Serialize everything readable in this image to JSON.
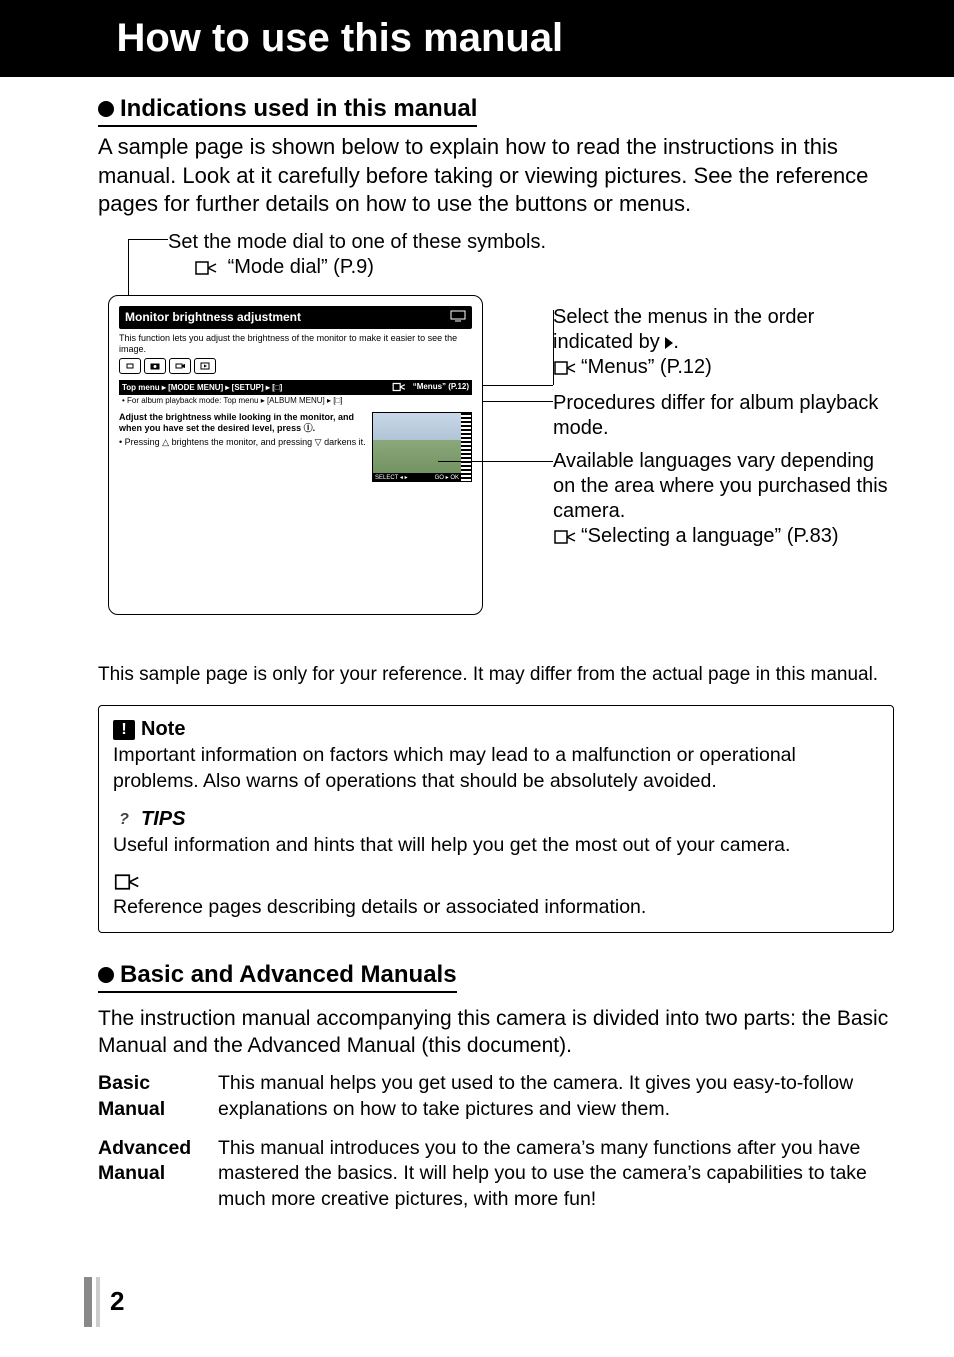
{
  "header": {
    "title": "How to use this manual"
  },
  "section1": {
    "heading": "Indications used in this manual",
    "intro": "A sample page is shown below to explain how to read the instructions in this manual. Look at it carefully before taking or viewing pictures. See the reference pages for further details on how to use the buttons or menus."
  },
  "diagram": {
    "mode_note_line1": "Set the mode dial to one of these symbols.",
    "mode_note_ref": "“Mode dial” (P.9)",
    "sample": {
      "title": "Monitor brightness adjustment",
      "subtitle": "This function lets you adjust the brightness of the monitor to make it easier to see the image.",
      "top_menu": "Top menu ▸ [MODE MENU] ▸ [SETUP] ▸ [□]",
      "top_menu_ref": "“Menus” (P.12)",
      "album_line": "• For album playback mode: Top menu ▸ [ALBUM MENU] ▸ [□]",
      "instr_bold": "Adjust the brightness while looking in the monitor, and when you have set the desired level, press Ⓘ.",
      "instr_sub": "•  Pressing △ brightens the monitor, and pressing ▽ darkens it.",
      "photo_select": "SELECT ◂ ▸",
      "photo_go": "GO ▸ OK"
    },
    "annot1_a": "Select the menus in the order indicated by",
    "annot1_ref": "“Menus” (P.12)",
    "annot2": "Procedures differ for album playback mode.",
    "annot3_a": "Available languages vary depending on the area where you purchased this camera.",
    "annot3_ref": "“Selecting a language” (P.83)",
    "caption": "This sample page is only for your reference. It may differ from the actual page in this manual."
  },
  "notes": {
    "note_head": "Note",
    "note_body": "Important information on factors which may lead to a malfunction or operational problems. Also warns of operations that should be absolutely avoided.",
    "tips_head": "TIPS",
    "tips_body": "Useful information and hints that will help you get the most out of your camera.",
    "ref_body": "Reference pages describing details or associated information."
  },
  "section2": {
    "heading": "Basic and Advanced Manuals",
    "intro": "The instruction manual accompanying this camera is divided into two parts: the Basic Manual and the Advanced Manual (this document).",
    "basic_label": "Basic Manual",
    "basic_desc": "This manual helps you get used to the camera. It gives you easy-to-follow explanations on how to take pictures and view them.",
    "adv_label": "Advanced Manual",
    "adv_desc": "This manual introduces you to the camera’s many functions after you have mastered the basics. It will help you to use the camera’s capabilities to take much more creative pictures, with more fun!"
  },
  "page_number": "2"
}
